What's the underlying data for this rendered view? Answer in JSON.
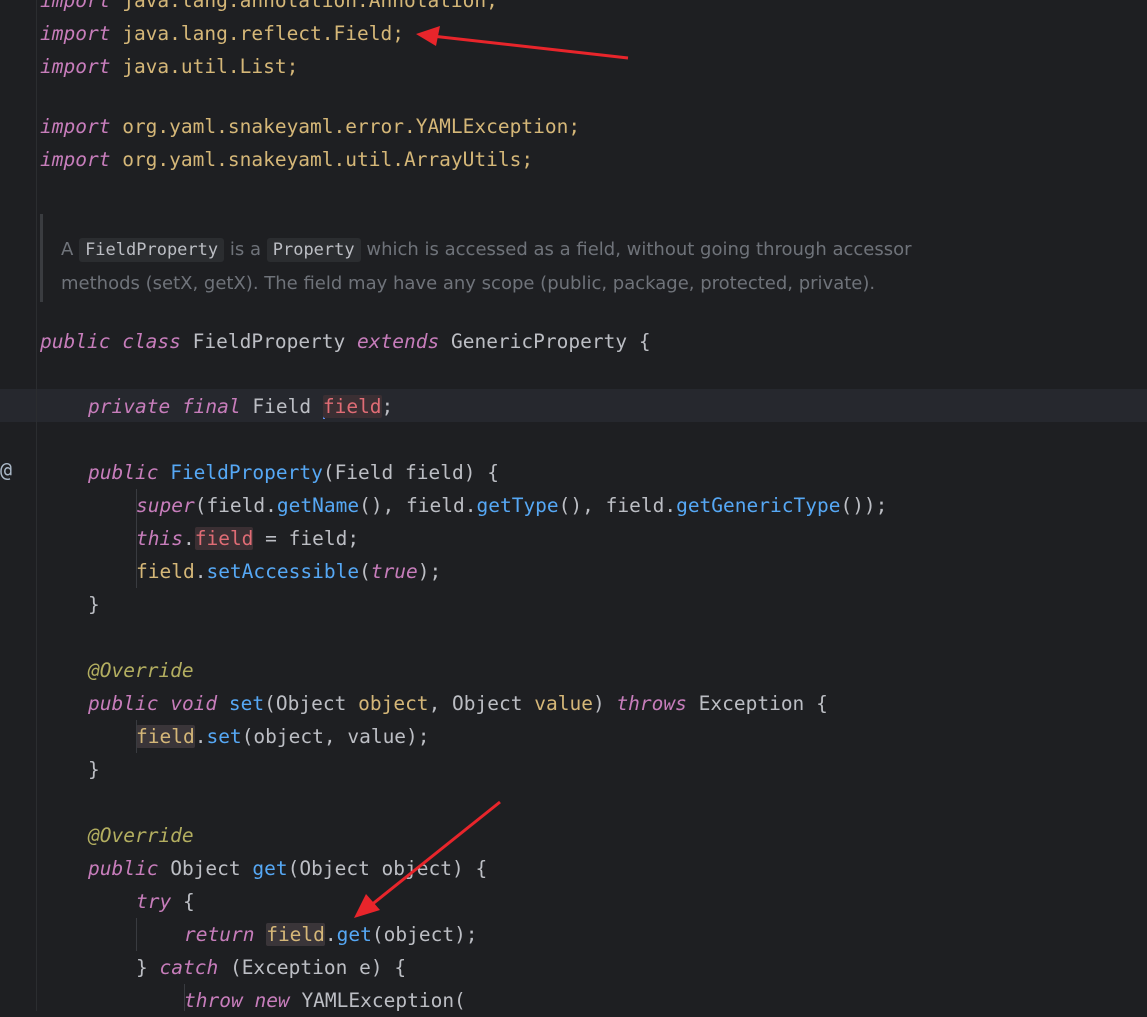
{
  "imports": [
    {
      "kw": "import",
      "path": "java.lang.annotation.Annotation;"
    },
    {
      "kw": "import",
      "path": "java.lang.reflect.Field;"
    },
    {
      "kw": "import",
      "path": "java.util.List;"
    },
    {
      "kw": "import",
      "path": "org.yaml.snakeyaml.error.YAMLException;"
    },
    {
      "kw": "import",
      "path": "org.yaml.snakeyaml.util.ArrayUtils;"
    }
  ],
  "doc": {
    "a": "A",
    "code1": "FieldProperty",
    "isa": "is a",
    "code2": "Property",
    "rest1": "which is accessed as a field, without going through accessor",
    "line2": "methods (setX, getX). The field may have any scope (public, package, protected, private)."
  },
  "code": {
    "public": "public",
    "class": "class",
    "className": "FieldProperty",
    "extends": "extends",
    "parent": "GenericProperty",
    "brace": "{",
    "private": "private",
    "final": "final",
    "Field": "Field",
    "field": "field",
    "semi": ";",
    "ctorName": "FieldProperty",
    "ctorParams": "(Field field) {",
    "super": "super",
    "superArgs1": "(field.",
    "getName": "getName",
    "superArgs2": "(), field.",
    "getType": "getType",
    "superArgs3": "(), field.",
    "getGenericType": "getGenericType",
    "superArgs4": "());",
    "this": "this",
    "dot": ".",
    "assignRest": " = field;",
    "fieldVar": "field",
    "setAccessible": "setAccessible",
    "true": "true",
    "closeParen": ");",
    "closeBrace": "}",
    "override": "@Override",
    "void": "void",
    "set": "set",
    "setSig1": "(Object ",
    "object": "object",
    "comma": ", ",
    "Object": "Object",
    "value": "value",
    "setSig2": ") ",
    "throws": "throws",
    "exception": "Exception",
    "setCall": "(object, value);",
    "get": "get",
    "getSig": "(Object object) {",
    "try": "try",
    "return": "return",
    "getCall": "(object);",
    "catch": "catch",
    "catchArgs": "(Exception e) {",
    "throw": "throw",
    "new": "new",
    "yamlEx": "YAMLException("
  },
  "gutter_icon": "@",
  "colors": {
    "background": "#1e1f22",
    "arrow": "#e8252b"
  }
}
